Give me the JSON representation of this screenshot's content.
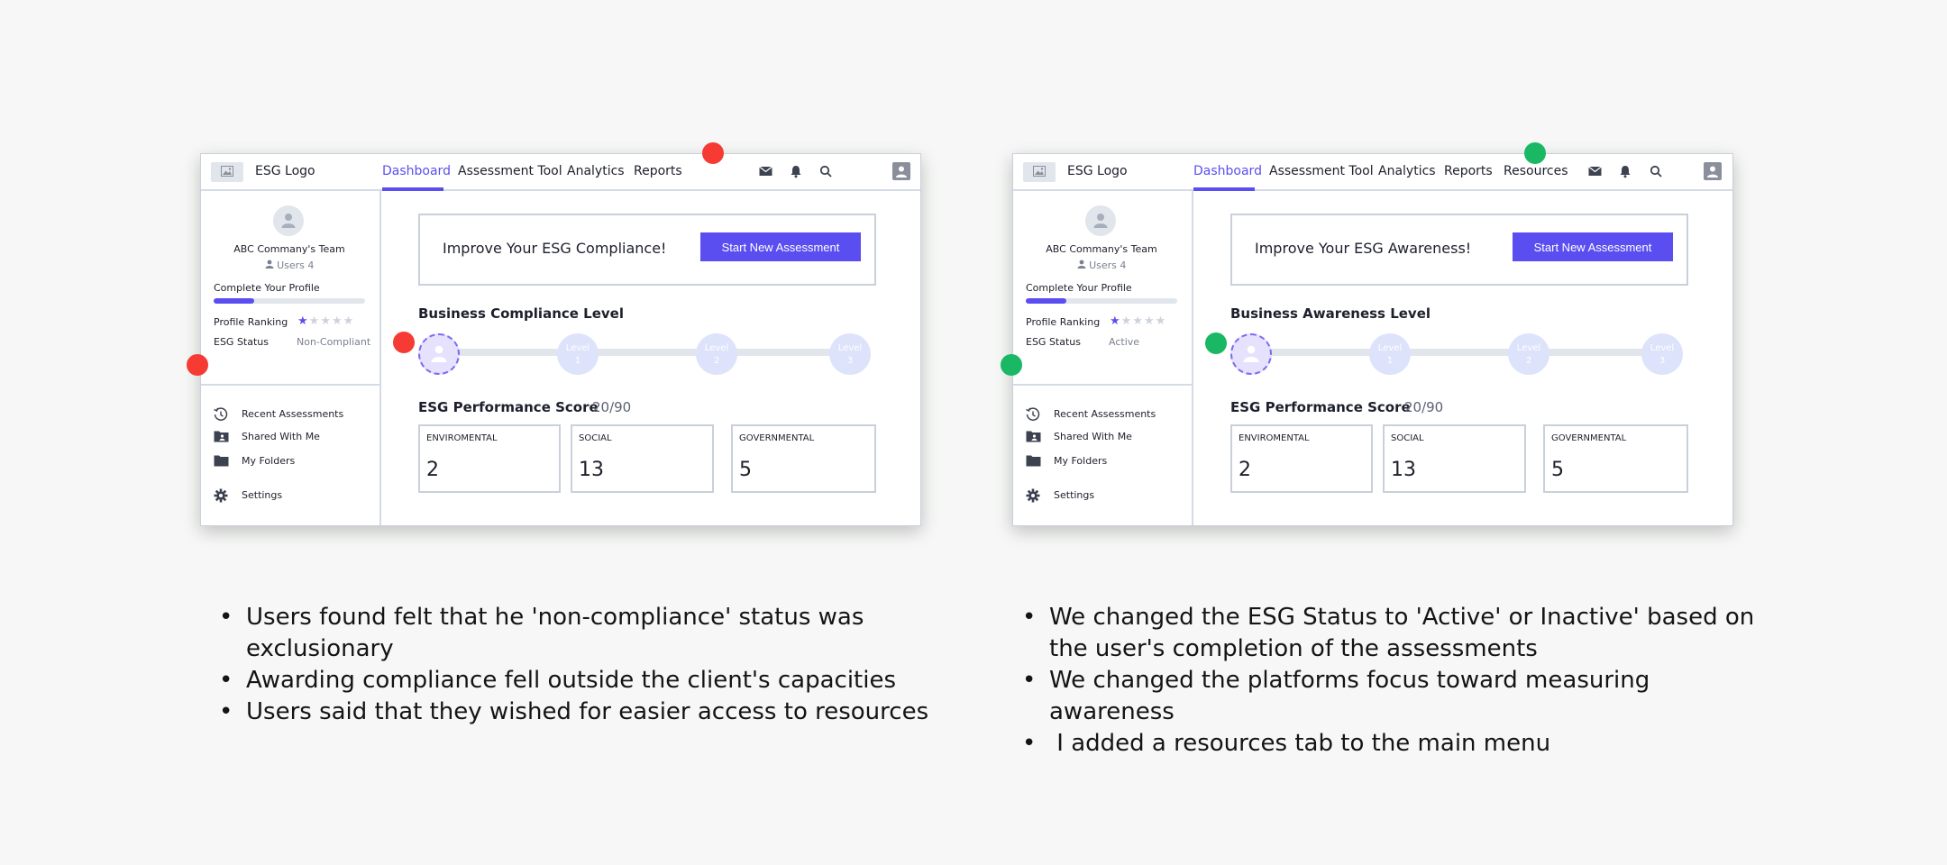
{
  "left": {
    "logo_text": "ESG Logo",
    "nav_tabs": [
      "Dashboard",
      "Assessment Tool",
      "Analytics",
      "Reports"
    ],
    "team_name": "ABC Commany's Team",
    "users": "Users 4",
    "complete_profile": "Complete Your Profile",
    "profile_progress": 0.27,
    "profile_ranking_label": "Profile Ranking",
    "stars_filled": 1,
    "stars_total": 5,
    "esg_status_label": "ESG Status",
    "esg_status_value": "Non-Compliant",
    "side_items": [
      "Recent Assessments",
      "Shared With Me",
      "My Folders",
      "Settings"
    ],
    "banner_text": "Improve Your ESG Compliance!",
    "start_button": "Start New Assessment",
    "level_title": "Business Compliance Level",
    "levels": [
      {
        "word": "Level",
        "num": "1"
      },
      {
        "word": "Level",
        "num": "2"
      },
      {
        "word": "Level",
        "num": "3"
      }
    ],
    "perf_title": "ESG Performance Score",
    "perf_score": "20/90",
    "scores": [
      {
        "label": "ENVIROMENTAL",
        "value": "2"
      },
      {
        "label": "SOCIAL",
        "value": "13"
      },
      {
        "label": "GOVERNMENTAL",
        "value": "5"
      }
    ]
  },
  "right": {
    "logo_text": "ESG Logo",
    "nav_tabs": [
      "Dashboard",
      "Assessment Tool",
      "Analytics",
      "Reports",
      "Resources"
    ],
    "team_name": "ABC Commany's Team",
    "users": "Users 4",
    "complete_profile": "Complete Your Profile",
    "profile_progress": 0.27,
    "profile_ranking_label": "Profile Ranking",
    "stars_filled": 1,
    "stars_total": 5,
    "esg_status_label": "ESG Status",
    "esg_status_value": "Active",
    "side_items": [
      "Recent Assessments",
      "Shared With Me",
      "My Folders",
      "Settings"
    ],
    "banner_text": "Improve Your ESG Awareness!",
    "start_button": "Start New Assessment",
    "level_title": "Business Awareness Level",
    "levels": [
      {
        "word": "Level",
        "num": "1"
      },
      {
        "word": "Level",
        "num": "2"
      },
      {
        "word": "Level",
        "num": "3"
      }
    ],
    "perf_title": "ESG Performance Score",
    "perf_score": "20/90",
    "scores": [
      {
        "label": "ENVIROMENTAL",
        "value": "2"
      },
      {
        "label": "SOCIAL",
        "value": "13"
      },
      {
        "label": "GOVERNMENTAL",
        "value": "5"
      }
    ]
  },
  "notes_left": [
    "Users found felt that he 'non-compliance' status was exclusionary",
    "Awarding compliance fell outside the client's capacities",
    "Users said that they wished for easier access to resources"
  ],
  "notes_right": [
    "We changed the ESG Status to 'Active' or Inactive' based on the user's completion of the assessments",
    "We changed the platforms focus toward measuring awareness",
    " I added a resources tab to the main menu"
  ],
  "colors": {
    "accent": "#5b4ef0",
    "marker_before": "#f53b33",
    "marker_after": "#1ab864",
    "border": "#c9d0db"
  },
  "icons": [
    "image-icon",
    "mail-icon",
    "bell-icon",
    "search-icon",
    "user-icon",
    "history-icon",
    "shared-folder-icon",
    "folder-icon",
    "gear-icon",
    "star-icon"
  ]
}
